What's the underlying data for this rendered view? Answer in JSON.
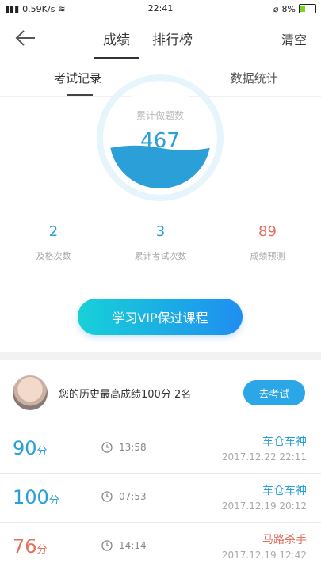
{
  "status": {
    "network": "0.59K/s",
    "time": "22:41",
    "battery": "8%"
  },
  "nav": {
    "tabs": [
      "成绩",
      "排行榜"
    ],
    "clear_label": "清空"
  },
  "subtabs": [
    "考试记录",
    "数据统计"
  ],
  "gauge": {
    "label": "累计做题数",
    "value": "467",
    "fill_fraction": 0.4
  },
  "stats": [
    {
      "value": "2",
      "label": "及格次数"
    },
    {
      "value": "3",
      "label": "累计考试次数"
    },
    {
      "value": "89",
      "label": "成绩预测"
    }
  ],
  "vip_button": "学习VIP保过课程",
  "profile": {
    "best_text": "您的历史最高成绩100分  2名",
    "go_button": "去考试"
  },
  "records": [
    {
      "score": "90",
      "unit": "分",
      "duration": "13:58",
      "title": "车仓车神",
      "date": "2017.12.22  22:11"
    },
    {
      "score": "100",
      "unit": "分",
      "duration": "07:53",
      "title": "车仓车神",
      "date": "2017.12.19  20:12"
    },
    {
      "score": "76",
      "unit": "分",
      "duration": "14:14",
      "title": "马路杀手",
      "date": "2017.12.19  12:42"
    }
  ],
  "colors": {
    "accent": "#2a9fd8",
    "warn": "#e07060"
  }
}
